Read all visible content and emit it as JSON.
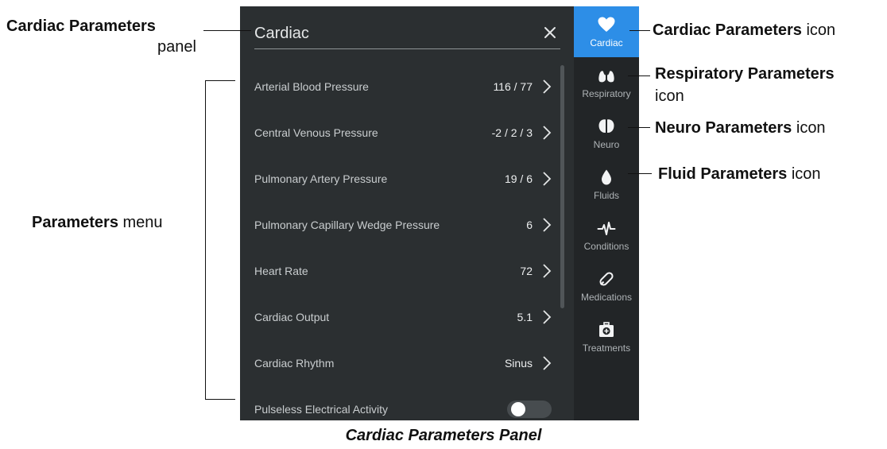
{
  "panel": {
    "search": {
      "value": "Cardiac",
      "placeholder": ""
    },
    "close_icon": "close-icon",
    "parameters": [
      {
        "label": "Arterial Blood Pressure",
        "value": "116 / 77",
        "type": "value"
      },
      {
        "label": "Central Venous Pressure",
        "value": "-2 / 2 / 3",
        "type": "value"
      },
      {
        "label": "Pulmonary Artery Pressure",
        "value": "19 / 6",
        "type": "value"
      },
      {
        "label": "Pulmonary Capillary Wedge Pressure",
        "value": "6",
        "type": "value"
      },
      {
        "label": "Heart Rate",
        "value": "72",
        "type": "value"
      },
      {
        "label": "Cardiac Output",
        "value": "5.1",
        "type": "value"
      },
      {
        "label": "Cardiac Rhythm",
        "value": "Sinus",
        "type": "value"
      },
      {
        "label": "Pulseless Electrical Activity",
        "value": "",
        "type": "toggle",
        "on": false
      }
    ]
  },
  "sidenav": {
    "items": [
      {
        "label": "Cardiac",
        "icon": "heart-icon",
        "active": true
      },
      {
        "label": "Respiratory",
        "icon": "lungs-icon",
        "active": false
      },
      {
        "label": "Neuro",
        "icon": "brain-icon",
        "active": false
      },
      {
        "label": "Fluids",
        "icon": "droplet-icon",
        "active": false
      },
      {
        "label": "Conditions",
        "icon": "pulse-icon",
        "active": false
      },
      {
        "label": "Medications",
        "icon": "pill-icon",
        "active": false
      },
      {
        "label": "Treatments",
        "icon": "medkit-icon",
        "active": false
      }
    ]
  },
  "annotations": {
    "cardiac_panel": {
      "bold": "Cardiac Parameters",
      "rest": "panel"
    },
    "parameters_menu": {
      "bold": "Parameters",
      "rest": " menu"
    },
    "cardiac_icon": {
      "bold": "Cardiac Parameters",
      "rest": " icon"
    },
    "respiratory_icon": {
      "bold": "Respiratory Parameters",
      "rest": "icon"
    },
    "neuro_icon": {
      "bold": "Neuro Parameters",
      "rest": " icon"
    },
    "fluid_icon": {
      "bold": "Fluid Parameters",
      "rest": " icon"
    },
    "caption": "Cardiac Parameters Panel"
  },
  "colors": {
    "panel_bg": "#2b2f31",
    "nav_bg": "#222527",
    "accent": "#2d8ee7"
  }
}
